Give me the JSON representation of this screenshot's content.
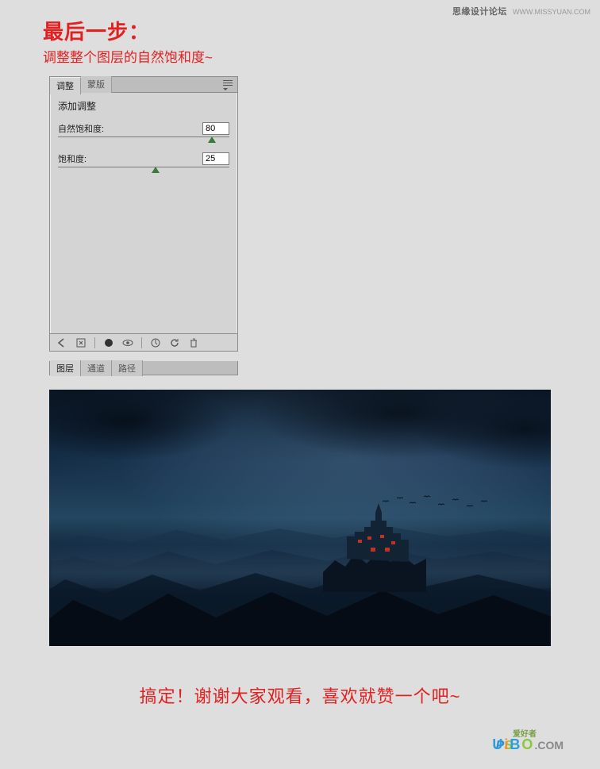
{
  "watermark_top": {
    "label": "思缘设计论坛",
    "url": "WWW.MISSYUAN.COM"
  },
  "title": "最后一步：",
  "subtitle": "调整整个图层的自然饱和度~",
  "panel": {
    "tabs": {
      "adjust": "调整",
      "mask": "蒙版"
    },
    "body_title": "添加调整",
    "vibrance": {
      "label": "自然饱和度:",
      "value": "80",
      "pos_pct": 90
    },
    "saturation": {
      "label": "饱和度:",
      "value": "25",
      "pos_pct": 57
    },
    "icons": {
      "back": "back-arrow-icon",
      "expand": "expand-icon",
      "circle": "circle-mask-icon",
      "eye": "visibility-icon",
      "clip": "clip-icon",
      "reset": "reset-icon",
      "trash": "trash-icon"
    }
  },
  "layers_strip": {
    "layers": "图层",
    "channels": "通道",
    "paths": "路径"
  },
  "closing": "搞定！谢谢大家观看，喜欢就赞一个吧~",
  "wm_bottom": {
    "ps_p": "P",
    "ps_s": "S",
    "tag": "爱好者",
    "u": "U",
    "i": "i",
    "b": "B",
    "o": "O",
    "com": ".COM"
  }
}
